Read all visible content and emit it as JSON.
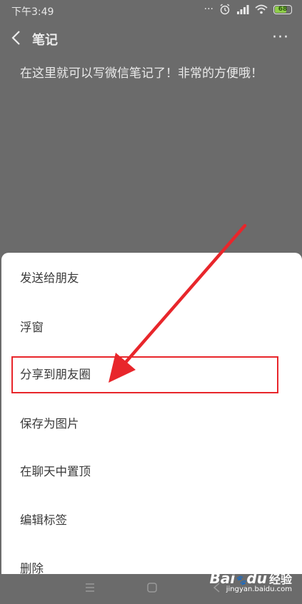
{
  "status_bar": {
    "time": "下午3:49",
    "battery_level": "68",
    "icons": [
      "alarm-icon",
      "signal-icon",
      "wifi-icon",
      "battery-icon"
    ]
  },
  "header": {
    "title": "笔记",
    "back_icon": "chevron-left-icon",
    "more_icon": "more-icon"
  },
  "note": {
    "content": "在这里就可以写微信笔记了！非常的方便哦！"
  },
  "sheet": {
    "items": [
      {
        "label": "发送给朋友"
      },
      {
        "label": "浮窗"
      },
      {
        "label": "分享到朋友圈",
        "highlighted": true
      },
      {
        "label": "保存为图片"
      },
      {
        "label": "在聊天中置顶"
      },
      {
        "label": "编辑标签"
      },
      {
        "label": "删除"
      }
    ],
    "highlight_color": "#e8262b"
  },
  "nav_bar": {
    "icons": [
      "menu-icon",
      "home-icon",
      "back-icon"
    ]
  },
  "watermark": {
    "logo": "Bai",
    "logo_suffix": "du",
    "jingyan": "经验",
    "url": "jingyan.baidu.com"
  },
  "annotation": {
    "arrow_color": "#e8262b"
  }
}
